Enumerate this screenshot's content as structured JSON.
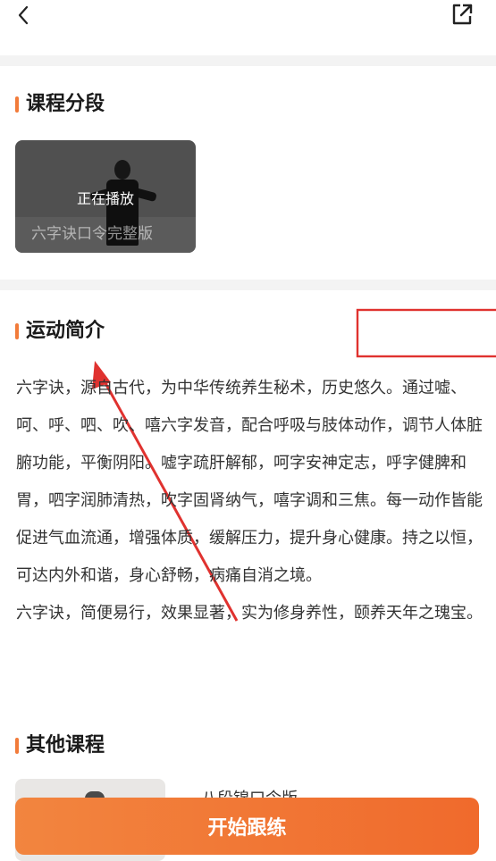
{
  "header": {
    "back_icon": "chevron-left-icon",
    "share_icon": "share-icon"
  },
  "segments": {
    "title": "课程分段",
    "items": [
      {
        "title": "六字诀口令完整版",
        "status": "正在播放"
      }
    ]
  },
  "intro": {
    "title": "运动简介",
    "paragraphs": [
      "六字诀，源自古代，为中华传统养生秘术，历史悠久。通过嘘、呵、呼、呬、吹、嘻六字发音，配合呼吸与肢体动作，调节人体脏腑功能，平衡阴阳。嘘字疏肝解郁，呵字安神定志，呼字健脾和胃，呬字润肺清热，吹字固肾纳气，嘻字调和三焦。每一动作皆能促进气血流通，增强体质，缓解压力，提升身心健康。持之以恒，可达内外和谐，身心舒畅，病痛自消之境。",
      "六字诀，简便易行，效果显著，实为修身养性，颐养天年之瑰宝。"
    ]
  },
  "other": {
    "title": "其他课程",
    "items": [
      {
        "title": "八段锦口令版"
      }
    ]
  },
  "cta": {
    "label": "开始跟练"
  },
  "colors": {
    "accent": "#f27b3a",
    "annotation": "#e0322f"
  }
}
